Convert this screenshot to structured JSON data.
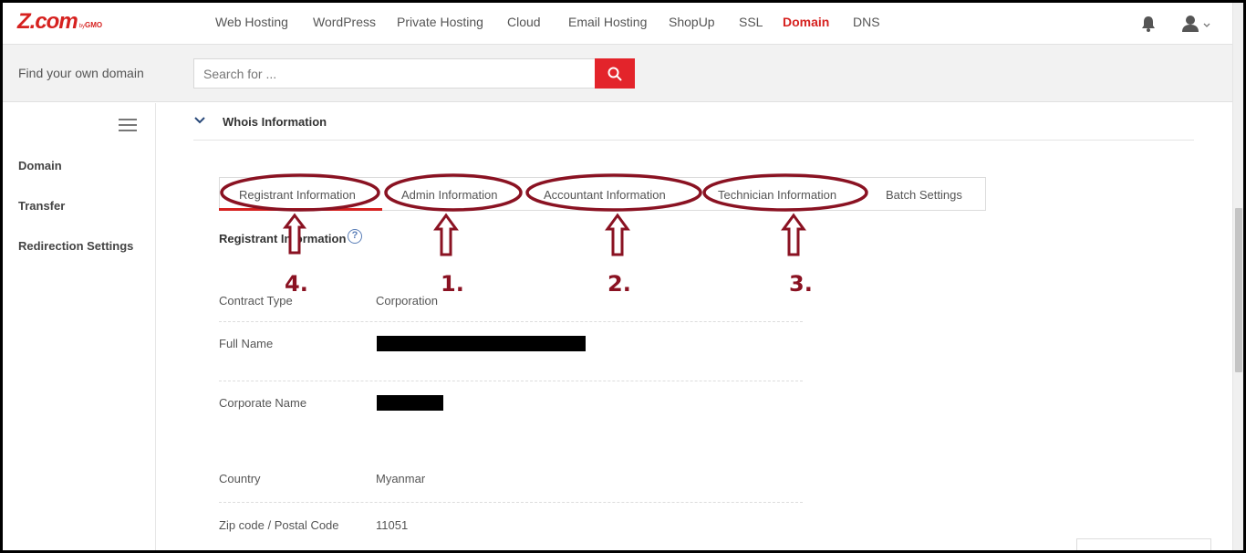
{
  "logo": {
    "main": "Z.com",
    "by": "by",
    "brand": "GMO"
  },
  "nav": {
    "items": [
      "Web Hosting",
      "WordPress",
      "Private Hosting",
      "Cloud",
      "Email Hosting",
      "ShopUp",
      "SSL",
      "Domain",
      "DNS"
    ],
    "active": "Domain"
  },
  "search": {
    "label": "Find your own domain",
    "placeholder": "Search for ..."
  },
  "sidebar": {
    "items": [
      "Domain",
      "Transfer",
      "Redirection Settings"
    ]
  },
  "section": {
    "title": "Whois Information"
  },
  "tabs": [
    "Registrant Information",
    "Admin Information",
    "Accountant Information",
    "Technician Information",
    "Batch Settings"
  ],
  "active_tab": "Registrant Information",
  "registrant": {
    "heading": "Registrant Information",
    "help": "?",
    "fields": [
      {
        "label": "Contract Type",
        "value": "Corporation"
      },
      {
        "label": "Full Name",
        "value": ""
      },
      {
        "label": "Corporate Name",
        "value": ""
      },
      {
        "label": "Country",
        "value": "Myanmar"
      },
      {
        "label": "Zip code / Postal Code",
        "value": "11051"
      }
    ]
  },
  "annotations": {
    "steps": [
      "4.",
      "1.",
      "2.",
      "3."
    ],
    "color": "#8a1222"
  },
  "colors": {
    "brand": "#d6211f",
    "search_button": "#e3242b"
  }
}
